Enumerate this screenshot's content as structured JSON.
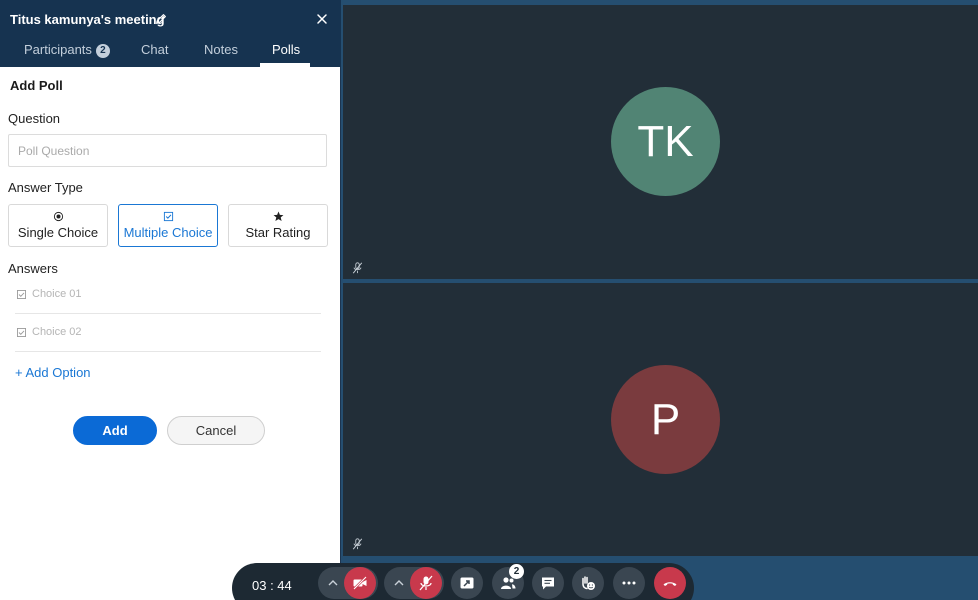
{
  "panel": {
    "title": "Titus kamunya's meeting",
    "tabs": [
      {
        "label": "Participants",
        "badge": "2"
      },
      {
        "label": "Chat"
      },
      {
        "label": "Notes"
      },
      {
        "label": "Polls"
      }
    ],
    "active_tab": "Polls"
  },
  "poll_form": {
    "heading": "Add Poll",
    "question_label": "Question",
    "question_placeholder": "Poll Question",
    "question_value": "",
    "answer_type_label": "Answer Type",
    "answer_types": [
      {
        "label": "Single Choice",
        "icon": "radio-icon"
      },
      {
        "label": "Multiple Choice",
        "icon": "checkbox-icon"
      },
      {
        "label": "Star Rating",
        "icon": "star-icon"
      }
    ],
    "selected_answer_type": "Multiple Choice",
    "answers_label": "Answers",
    "choices": [
      {
        "placeholder": "Choice 01"
      },
      {
        "placeholder": "Choice 02"
      }
    ],
    "add_option_label": "+ Add Option",
    "add_button_label": "Add",
    "cancel_button_label": "Cancel"
  },
  "participants": [
    {
      "initials": "TK",
      "color": "#518474",
      "muted": true
    },
    {
      "initials": "P",
      "color": "#7a3b3e",
      "muted": true
    }
  ],
  "controls": {
    "timer": "03 : 44",
    "participants_count": "2",
    "buttons": [
      "video-off",
      "mic-off",
      "share-screen",
      "participants",
      "chat",
      "reactions",
      "more",
      "end-call"
    ]
  },
  "colors": {
    "header_bg": "#163350",
    "accent": "#1a77d4",
    "primary_button": "#0b6ad6",
    "danger": "#c8394c",
    "tile_bg": "#222e38",
    "stage_bg": "#254e70"
  }
}
